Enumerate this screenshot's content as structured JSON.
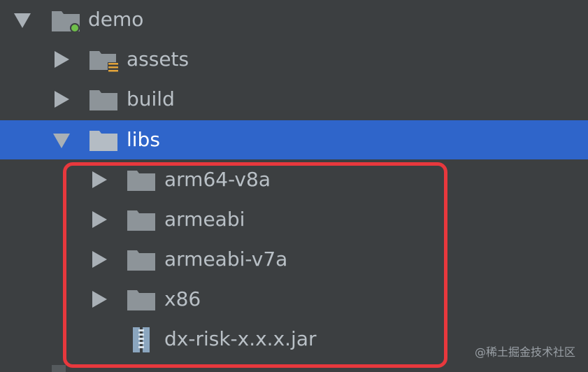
{
  "tree": {
    "root": {
      "label": "demo",
      "icon": "module-folder-icon",
      "expanded": true
    },
    "items": [
      {
        "label": "assets",
        "icon": "resources-folder-icon",
        "expanded": false
      },
      {
        "label": "build",
        "icon": "folder-icon",
        "expanded": false
      },
      {
        "label": "libs",
        "icon": "folder-icon",
        "expanded": true,
        "selected": true
      },
      {
        "label": "arm64-v8a",
        "icon": "folder-icon",
        "expanded": false
      },
      {
        "label": "armeabi",
        "icon": "folder-icon",
        "expanded": false
      },
      {
        "label": "armeabi-v7a",
        "icon": "folder-icon",
        "expanded": false
      },
      {
        "label": "x86",
        "icon": "folder-icon",
        "expanded": false
      },
      {
        "label": "dx-risk-x.x.x.jar",
        "icon": "jar-file-icon"
      }
    ]
  },
  "colors": {
    "background": "#3c3f41",
    "selection": "#2f65ca",
    "highlight_border": "#e8383d",
    "folder": "#8d9499",
    "module_dot": "#6fbf4a",
    "resource_lines": "#e3a43a"
  },
  "watermark": "@稀土掘金技术社区"
}
